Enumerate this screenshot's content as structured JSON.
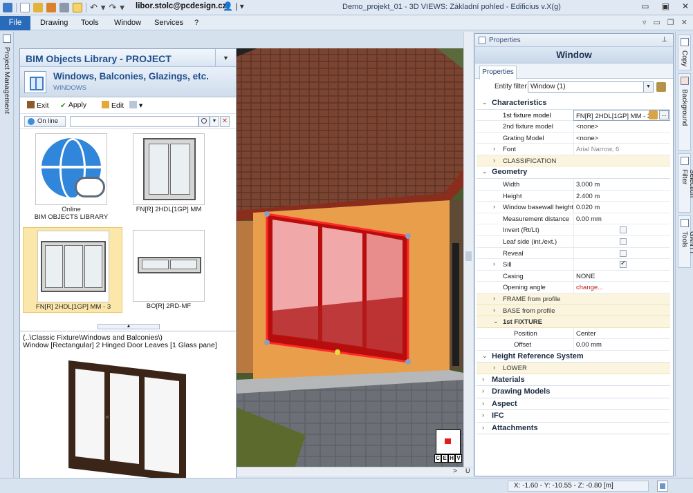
{
  "titlebar": {
    "user_email": "libor.stolc@pcdesign.cz",
    "window_title": "Demo_projekt_01 - 3D VIEWS: Základní pohled - Edificius v.X(g)"
  },
  "menu": {
    "file": "File",
    "items": [
      "Drawing",
      "Tools",
      "Window",
      "Services",
      "?"
    ]
  },
  "left_tab": {
    "label": "Project Management"
  },
  "library": {
    "title": "BIM Objects Library - PROJECT",
    "category_title": "Windows, Balconies, Glazings, etc.",
    "category_sub": "WINDOWS",
    "toolbar": {
      "exit": "Exit",
      "apply": "Apply",
      "edit": "Edit"
    },
    "online_btn": "On line",
    "search_value": "",
    "items": [
      {
        "label_line1": "Online",
        "label_line2": "BIM OBJECTS LIBRARY"
      },
      {
        "label_line1": "FN[R] 2HDL[1GP] MM",
        "label_line2": ""
      },
      {
        "label_line1": "FN[R] 2HDL[1GP] MM - 3",
        "label_line2": ""
      },
      {
        "label_line1": "BO[R] 2RD-MF",
        "label_line2": ""
      }
    ],
    "preview_path": "(..\\Classic Fixture\\Windows and Balconies\\)",
    "preview_desc": "Window [Rectangular] 2 Hinged Door Leaves [1 Glass pane]"
  },
  "view": {
    "nav_views": [
      "C",
      "E",
      "H",
      "V"
    ],
    "u_label": "U"
  },
  "properties": {
    "header": "Properties",
    "object": "Window",
    "tab": "Properties",
    "filter_label": "Entity filter",
    "filter_value": "Window (1)",
    "groups": {
      "characteristics": "Characteristics",
      "geometry": "Geometry",
      "height_ref": "Height Reference System",
      "materials": "Materials",
      "drawing_models": "Drawing Models",
      "aspect": "Aspect",
      "ifc": "IFC",
      "attachments": "Attachments"
    },
    "rows": {
      "fixture1_label": "1st fixture model",
      "fixture1_value": "FN[R] 2HDL[1GP] MM - 3",
      "fixture2_label": "2nd fixture model",
      "fixture2_value": "<none>",
      "grating_label": "Grating Model",
      "grating_value": "<none>",
      "font_label": "Font",
      "font_value": "Arial Narrow, 6",
      "classification": "CLASSIFICATION",
      "width_label": "Width",
      "width_value": "3.000 m",
      "height_label": "Height",
      "height_value": "2.400 m",
      "basewall_label": "Window basewall height",
      "basewall_value": "0.020 m",
      "measure_label": "Measurement distance",
      "measure_value": "0.00 mm",
      "invert_label": "Invert (Rt/Lt)",
      "leaf_label": "Leaf side (int./ext.)",
      "reveal_label": "Reveal",
      "sill_label": "Sill",
      "casing_label": "Casing",
      "casing_value": "NONE",
      "opening_label": "Opening angle",
      "opening_value": "change...",
      "frame_profile": "FRAME from profile",
      "base_profile": "BASE from profile",
      "fixture1_group": "1st FIXTURE",
      "position_label": "Position",
      "position_value": "Center",
      "offset_label": "Offset",
      "offset_value": "0.00 mm",
      "lower": "LOWER"
    }
  },
  "right_tabs": [
    "Copy",
    "Background",
    "Selection Filter",
    "GANTT Tools"
  ],
  "status": {
    "coords": "X: -1.60 - Y: -10.55 - Z: -0.80 [m]"
  }
}
